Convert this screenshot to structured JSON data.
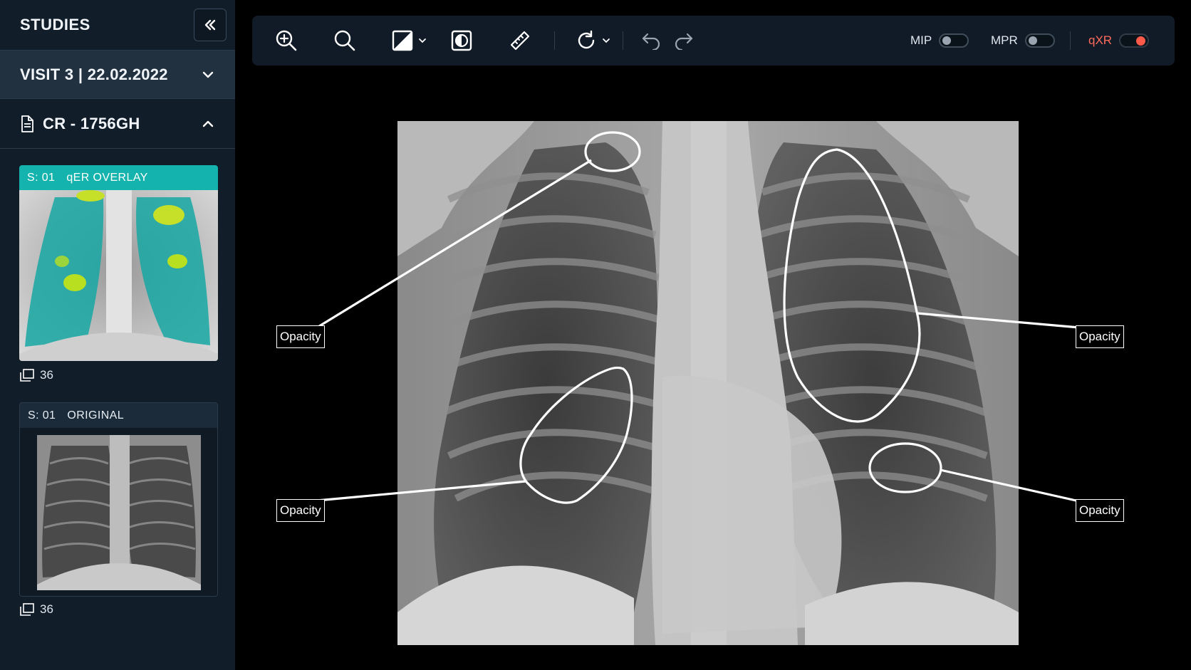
{
  "sidebar": {
    "title": "STUDIES",
    "visit": {
      "label": "VISIT 3 | 22.02.2022"
    },
    "study": {
      "label": "CR - 1756GH"
    },
    "series": [
      {
        "series_no": "S: 01",
        "name": "qER OVERLAY",
        "image_count": "36",
        "active": true
      },
      {
        "series_no": "S: 01",
        "name": "ORIGINAL",
        "image_count": "36",
        "active": false
      }
    ]
  },
  "toolbar": {
    "icons": [
      "zoom-in-icon",
      "magnifier-icon",
      "window-level-icon",
      "invert-icon",
      "ruler-icon",
      "rotate-icon",
      "undo-icon",
      "redo-icon"
    ],
    "toggles": [
      {
        "label": "MIP",
        "on": false
      },
      {
        "label": "MPR",
        "on": false
      },
      {
        "label": "qXR",
        "on": true
      }
    ]
  },
  "viewer": {
    "annotations": [
      {
        "label": "Opacity"
      },
      {
        "label": "Opacity"
      },
      {
        "label": "Opacity"
      },
      {
        "label": "Opacity"
      }
    ]
  },
  "colors": {
    "accent": "#14b3ad",
    "toggle_on": "#ff5a4a",
    "sidebar_bg": "#111d29",
    "toolbar_bg": "#111b27"
  }
}
